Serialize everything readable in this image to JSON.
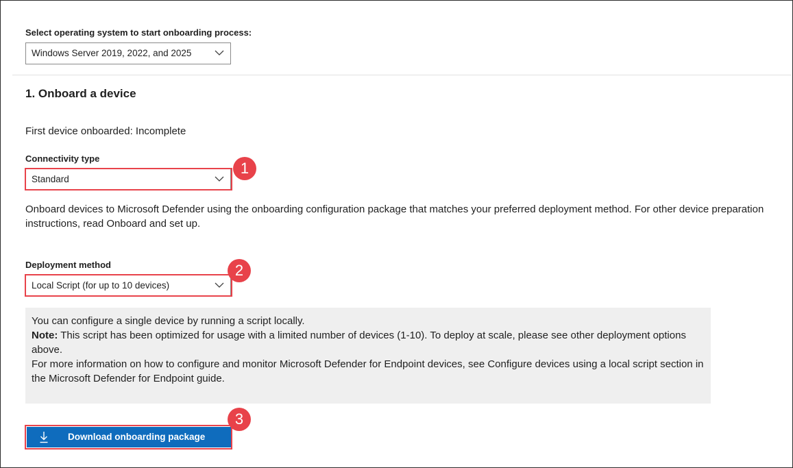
{
  "os_select": {
    "label": "Select operating system to start onboarding process:",
    "value": "Windows Server 2019, 2022, and 2025"
  },
  "section": {
    "heading": "1. Onboard a device",
    "status_text": "First device onboarded: Incomplete"
  },
  "connectivity": {
    "label": "Connectivity type",
    "value": "Standard"
  },
  "description": "Onboard devices to Microsoft Defender using the onboarding configuration package that matches your preferred deployment method. For other device preparation instructions, read Onboard and set up.",
  "deployment": {
    "label": "Deployment method",
    "value": "Local Script (for up to 10 devices)"
  },
  "info": {
    "line1": "You can configure a single device by running a script locally.",
    "note_label": "Note:",
    "note_text": " This script has been optimized for usage with a limited number of devices (1-10). To deploy at scale, please see other deployment options above.",
    "line3": "For more information on how to configure and monitor Microsoft Defender for Endpoint devices, see Configure devices using a local script section in the Microsoft Defender for Endpoint guide."
  },
  "download_button": {
    "label": "Download onboarding package",
    "icon": "download-icon"
  },
  "annotations": [
    "1",
    "2",
    "3"
  ],
  "colors": {
    "accent": "#0f6cbd",
    "annotation": "#e8424a",
    "info_background": "#efefef"
  }
}
